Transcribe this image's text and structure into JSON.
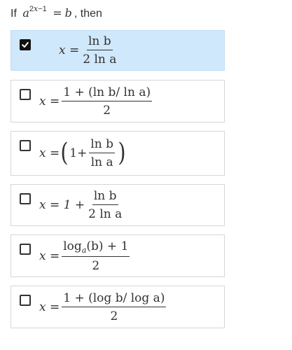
{
  "question": {
    "prefix": "If",
    "base": "a",
    "exponent_coef": "2",
    "exponent_var": "x",
    "exponent_rest": "−1",
    "equals": "=",
    "rhs": "b",
    "suffix": ", then"
  },
  "options": [
    {
      "selected": true,
      "lhs": "x =",
      "numerator": "ln b",
      "denominator": "2 ln a"
    },
    {
      "selected": false,
      "lhs": "x =",
      "numerator": "1 + (ln b/ ln a)",
      "denominator": "2"
    },
    {
      "selected": false,
      "lhs": "x =",
      "open_paren": "(",
      "close_paren": ")",
      "one": "1",
      "plus": "+",
      "numerator": "ln b",
      "denominator": "ln a"
    },
    {
      "selected": false,
      "lhs": "x = 1 +",
      "numerator": "ln b",
      "denominator": "2 ln a"
    },
    {
      "selected": false,
      "lhs": "x =",
      "num_log": "log",
      "num_sub": "a",
      "num_rest": "(b) + 1",
      "denominator": "2"
    },
    {
      "selected": false,
      "lhs": "x =",
      "numerator": "1 + (log b/ log a)",
      "denominator": "2"
    }
  ],
  "icons": {
    "checkbox_checked": "checkmark-icon",
    "checkbox_unchecked": "checkbox-empty-icon"
  },
  "colors": {
    "selected_background": "#cfe8fc",
    "border": "#d6d6d6",
    "text": "#333333"
  }
}
